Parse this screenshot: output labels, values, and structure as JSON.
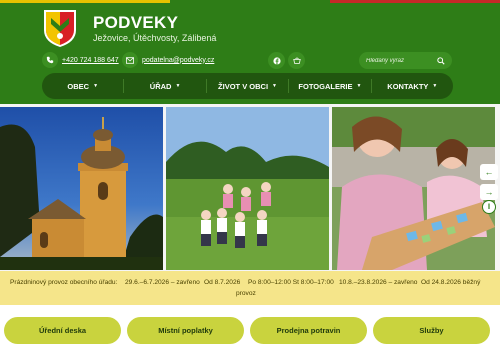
{
  "header": {
    "title": "PODVEKY",
    "subtitle": "Ježovice, Útěchvosty, Zálibená",
    "phone": "+420 724 188 647",
    "email": "podatelna@podveky.cz",
    "search_placeholder": "Hledaný výraz"
  },
  "nav": {
    "items": [
      {
        "label": "OBEC"
      },
      {
        "label": "ÚŘAD"
      },
      {
        "label": "ŽIVOT V OBCI"
      },
      {
        "label": "FOTOGALERIE"
      },
      {
        "label": "KONTAKTY"
      }
    ]
  },
  "notice": {
    "lines": [
      "Prázdninový provoz obecního úřadu:",
      "29.6.–6.7.2026 – zavřeno",
      "Od 8.7.2026",
      "Po 8:00–12:00 St 8:00–17:00",
      "10.8.–23.8.2026 – zavřeno",
      "Od 24.8.2026 běžný",
      "provoz"
    ]
  },
  "buttons": [
    {
      "label": "Úřední deska"
    },
    {
      "label": "Místní poplatky"
    },
    {
      "label": "Prodejna potravin"
    },
    {
      "label": "Služby"
    }
  ],
  "icons": {
    "phone": "phone-icon",
    "email": "envelope-icon",
    "facebook": "facebook-icon",
    "shop": "shop-icon",
    "search": "search-icon",
    "prev": "arrow-left-icon",
    "next": "arrow-right-icon",
    "pause": "pause-icon"
  },
  "colors": {
    "header": "#2e7d17",
    "nav": "#21560f",
    "notice": "#f5e58a",
    "button": "#c9d33e"
  }
}
